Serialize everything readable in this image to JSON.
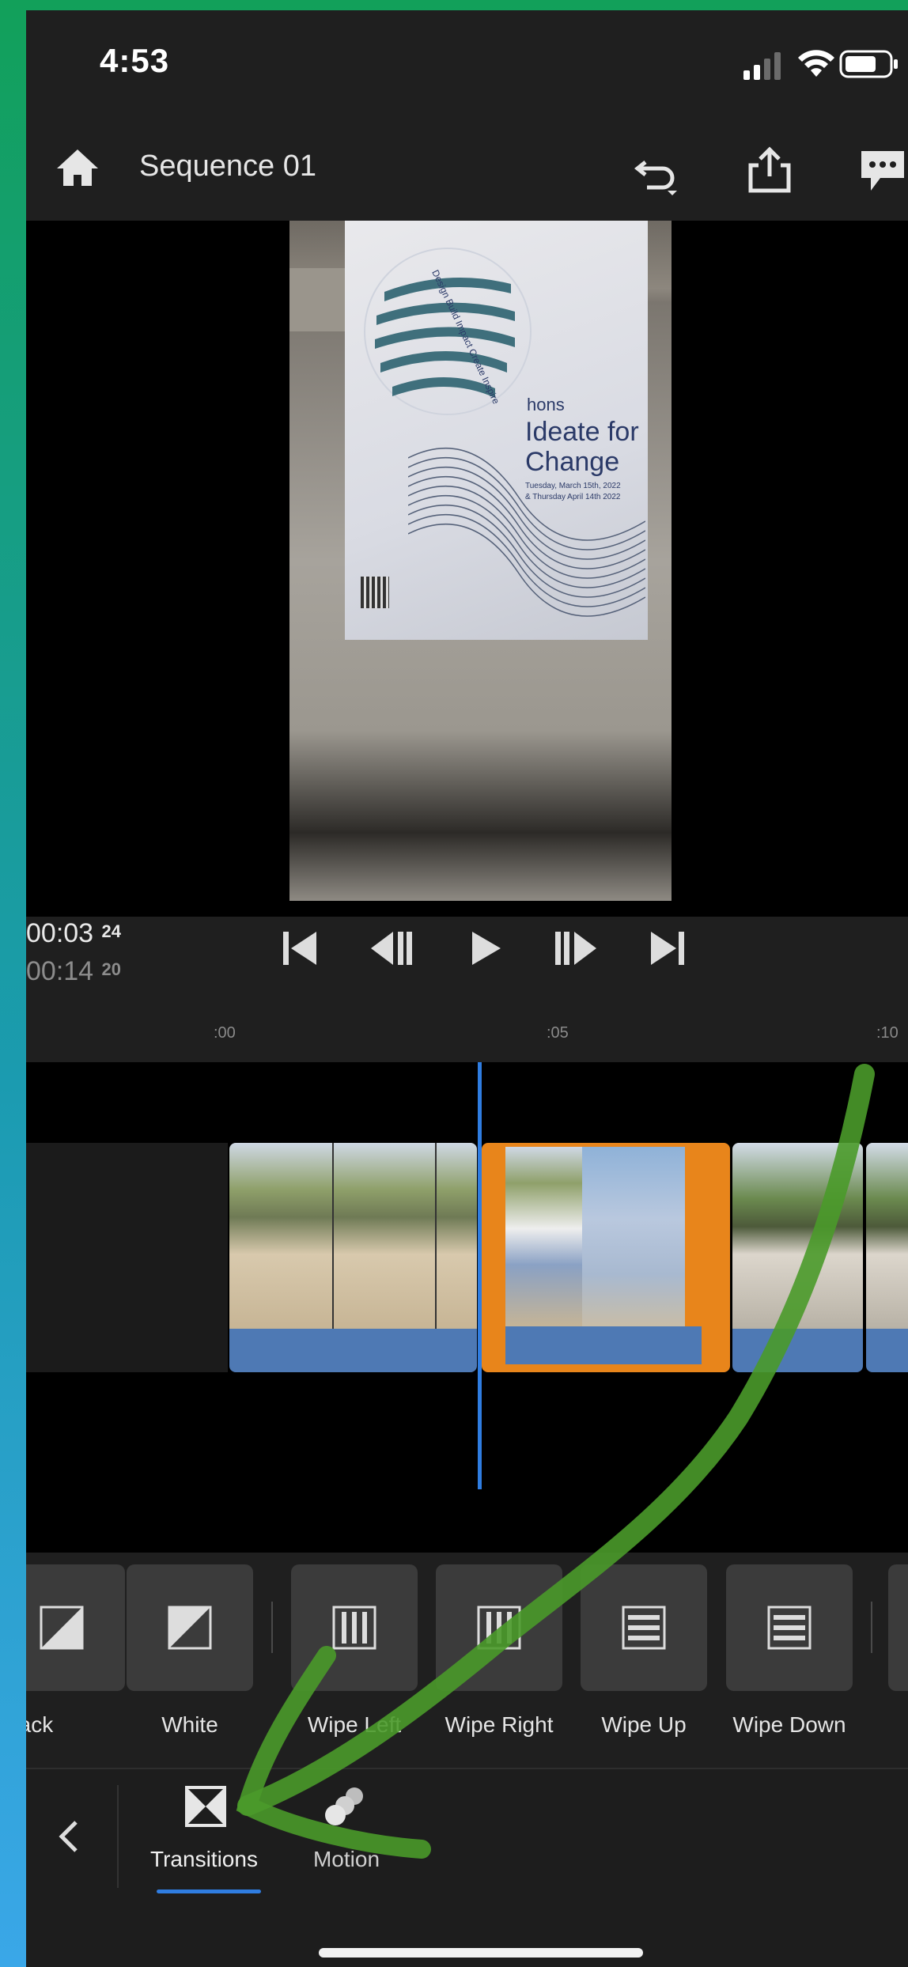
{
  "status": {
    "time": "4:53"
  },
  "header": {
    "title": "Sequence 01"
  },
  "poster": {
    "brand": "hons",
    "headline_line1": "Ideate for",
    "headline_line2": "Change",
    "tagline": "Design Build Impact Create Inspire",
    "date_line1": "Tuesday, March 15th, 2022",
    "date_line2": "& Thursday April 14th 2022"
  },
  "timecode": {
    "current_main": "00:03",
    "current_frames": "24",
    "total_main": "00:14",
    "total_frames": "20"
  },
  "ruler": {
    "marks": [
      ":00",
      ":05",
      ":10"
    ]
  },
  "transitions": {
    "items": [
      {
        "label": "Black",
        "icon": "half-black-square-icon"
      },
      {
        "label": "White",
        "icon": "half-white-square-icon"
      },
      {
        "label": "Wipe Left",
        "icon": "vertical-bars-icon"
      },
      {
        "label": "Wipe Right",
        "icon": "vertical-bars-icon"
      },
      {
        "label": "Wipe Up",
        "icon": "horizontal-bars-icon"
      },
      {
        "label": "Wipe Down",
        "icon": "horizontal-bars-icon"
      }
    ]
  },
  "tabs": [
    {
      "label": "Transitions",
      "icon": "transitions-icon",
      "active": true
    },
    {
      "label": "Motion",
      "icon": "motion-icon",
      "active": false
    }
  ],
  "colors": {
    "accent_blue": "#2f7de1",
    "selected_clip": "#e8851b",
    "annotation_green": "#4a9a2a",
    "background": "#1f1f1f"
  }
}
